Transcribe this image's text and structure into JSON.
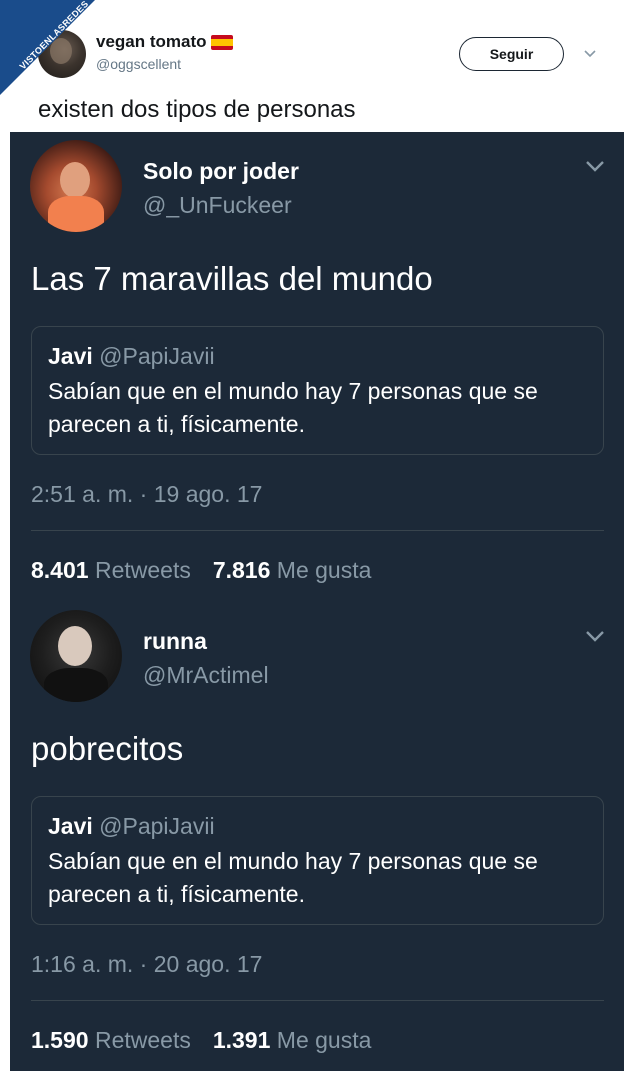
{
  "watermark": "VISTOENLASREDES",
  "outer_tweet": {
    "name": "vegan tomato",
    "handle": "@oggscellent",
    "follow_label": "Seguir",
    "text": "existen dos tipos de personas"
  },
  "tweets": [
    {
      "name": "Solo por joder",
      "handle": "@_UnFuckeer",
      "text": "Las 7 maravillas del mundo",
      "quote": {
        "name": "Javi",
        "handle": "@PapiJavii",
        "text": "Sabían que en el mundo hay 7 personas que se parecen a ti, físicamente."
      },
      "timestamp": "2:51 a. m. · 19 ago. 17",
      "retweets": "8.401",
      "retweets_label": "Retweets",
      "likes": "7.816",
      "likes_label": "Me gusta"
    },
    {
      "name": "runna",
      "handle": "@MrActimel",
      "text": "pobrecitos",
      "quote": {
        "name": "Javi",
        "handle": "@PapiJavii",
        "text": "Sabían que en el mundo hay 7 personas que se parecen a ti, físicamente."
      },
      "timestamp": "1:16 a. m. · 20 ago. 17",
      "retweets": "1.590",
      "retweets_label": "Retweets",
      "likes": "1.391",
      "likes_label": "Me gusta"
    }
  ]
}
